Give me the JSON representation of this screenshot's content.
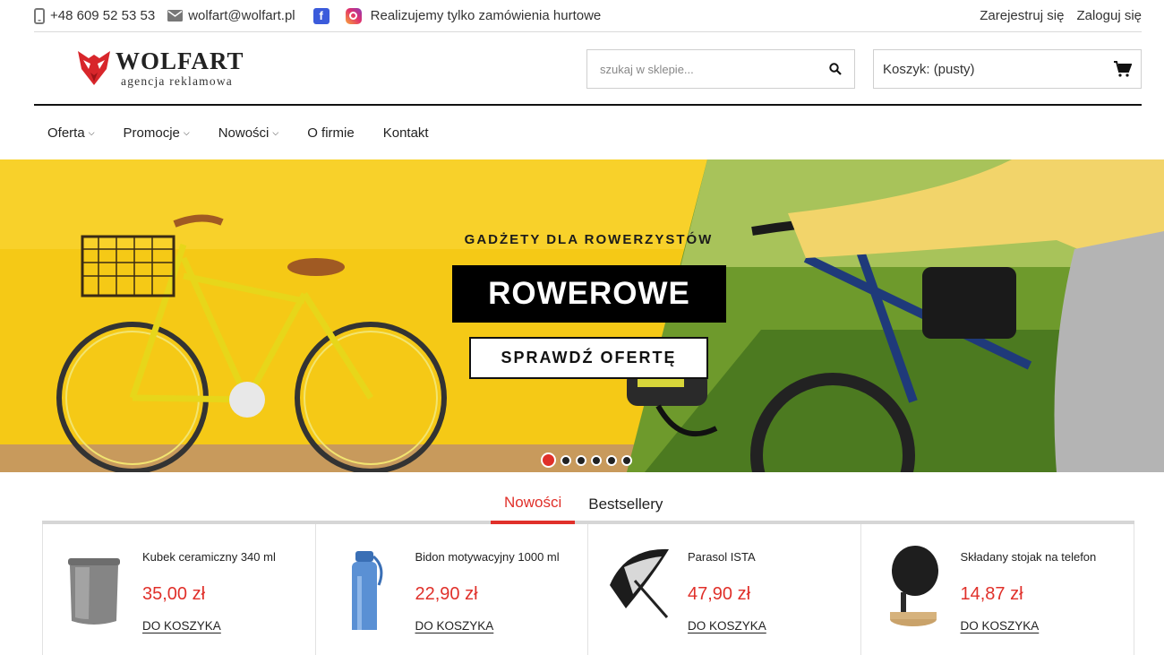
{
  "topbar": {
    "phone": "+48 609 52 53 53",
    "email": "wolfart@wolfart.pl",
    "facebook_letter": "f",
    "note": "Realizujemy tylko zamówienia hurtowe",
    "register": "Zarejestruj się",
    "login": "Zaloguj się"
  },
  "logo": {
    "brand": "WOLFART",
    "sub": "agencja reklamowa"
  },
  "search": {
    "placeholder": "szukaj w sklepie..."
  },
  "cart": {
    "label": "Koszyk:",
    "status": "(pusty)"
  },
  "nav": [
    {
      "label": "Oferta",
      "dropdown": true
    },
    {
      "label": "Promocje",
      "dropdown": true
    },
    {
      "label": "Nowości",
      "dropdown": true
    },
    {
      "label": "O firmie",
      "dropdown": false
    },
    {
      "label": "Kontakt",
      "dropdown": false
    }
  ],
  "hero": {
    "subtitle": "GADŻETY DLA ROWERZYSTÓW",
    "title": "ROWEROWE",
    "cta": "SPRAWDŹ OFERTĘ",
    "slides": 6,
    "active_slide": 1
  },
  "tabs": [
    "Nowości",
    "Bestsellery"
  ],
  "products": [
    {
      "name": "Kubek ceramiczny 340 ml",
      "price": "35,00 zł",
      "action": "DO KOSZYKA",
      "icon": "mug-icon"
    },
    {
      "name": "Bidon motywacyjny 1000 ml",
      "price": "22,90 zł",
      "action": "DO KOSZYKA",
      "icon": "bottle-icon"
    },
    {
      "name": "Parasol ISTA",
      "price": "47,90 zł",
      "action": "DO KOSZYKA",
      "icon": "umbrella-icon"
    },
    {
      "name": "Składany stojak na telefon",
      "price": "14,87 zł",
      "action": "DO KOSZYKA",
      "icon": "phone-stand-icon"
    }
  ],
  "colors": {
    "accent": "#e0302a",
    "hero_yellow": "#f4c81b",
    "dark": "#111111"
  }
}
